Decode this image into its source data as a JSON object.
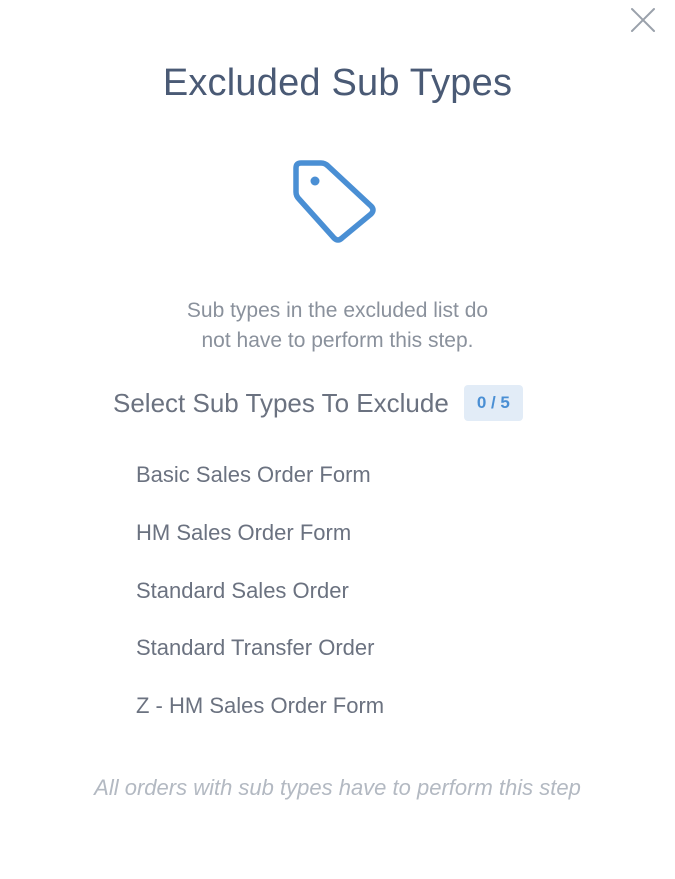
{
  "modal": {
    "title": "Excluded Sub Types",
    "close_icon": "close-icon",
    "header_icon": "tag-icon",
    "description_line1": "Sub types in the excluded list do",
    "description_line2": "not have to perform this step.",
    "select_title": "Select Sub Types To Exclude",
    "count_badge": "0 / 5",
    "subtypes": [
      "Basic Sales Order Form",
      "HM Sales Order Form",
      "Standard Sales Order",
      "Standard Transfer Order",
      "Z - HM Sales Order Form"
    ],
    "footer_note": "All orders with sub types have to perform this step"
  },
  "colors": {
    "accent": "#4a8fd4",
    "title": "#4a5a75",
    "text": "#6b7280",
    "muted": "#b3b9c2",
    "badge_bg": "#e2ecf7"
  }
}
